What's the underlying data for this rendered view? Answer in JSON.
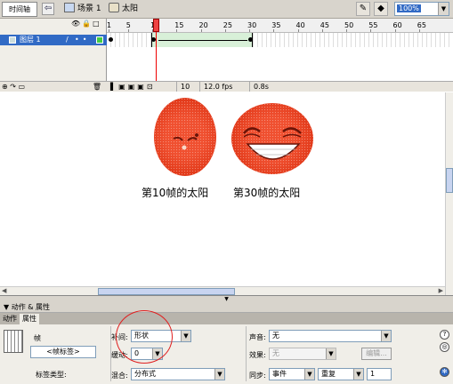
{
  "topbar": {
    "timeline_button": "时间轴",
    "back_arrow": "⇦",
    "scene": "场景 1",
    "symbol": "太阳",
    "zoom": "100%"
  },
  "timeline": {
    "layer_name": "图层 1",
    "frame_numbers": [
      "1",
      "5",
      "10",
      "15",
      "20",
      "25",
      "30",
      "35",
      "40",
      "45",
      "50",
      "55",
      "60",
      "65"
    ],
    "current_frame": "10",
    "fps": "12.0 fps",
    "time": "0.8s"
  },
  "stage": {
    "caption_left": "第10帧的太阳",
    "caption_right": "第30帧的太阳"
  },
  "panel": {
    "title": "▼ 动作 & 属性",
    "tab_actions": "动作",
    "tab_properties": "属性",
    "frame_label": "帧",
    "frame_name_placeholder": "<帧标签>",
    "label_type": "标签类型:",
    "tween_label": "补间:",
    "tween_value": "形状",
    "ease_label": "缓动:",
    "ease_value": "0",
    "blend_label": "混合:",
    "blend_value": "分布式",
    "sound_label": "声音:",
    "sound_value": "无",
    "effect_label": "效果:",
    "effect_value": "无",
    "edit_button": "编辑...",
    "sync_label": "同步:",
    "sync_value": "事件",
    "repeat_value": "重复",
    "repeat_count": "1"
  },
  "colors": {
    "sun": "#e6421e",
    "selection": "#316ac5",
    "annotation_circle": "#e02020"
  }
}
